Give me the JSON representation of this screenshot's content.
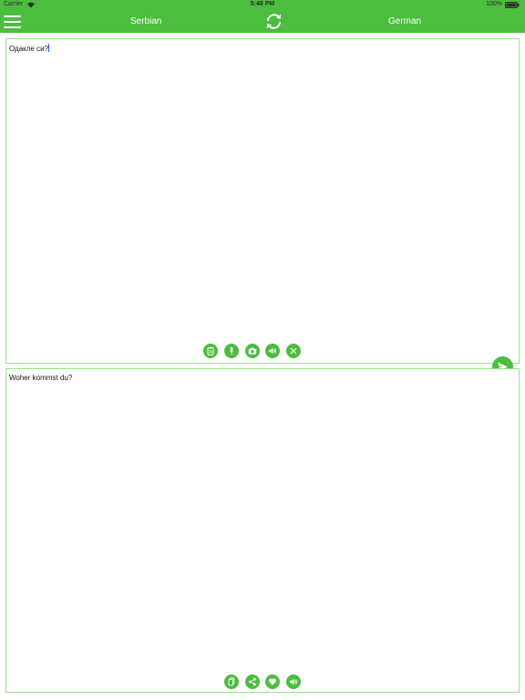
{
  "status_bar": {
    "carrier": "Carrier",
    "time": "5:48 PM",
    "battery": "100%"
  },
  "nav": {
    "source_language": "Serbian",
    "target_language": "German"
  },
  "input_panel": {
    "text": "Одакле си?"
  },
  "output_panel": {
    "text": "Woher kommst du?"
  },
  "icons": {
    "menu": "hamburger-menu-icon",
    "swap": "swap-languages-icon",
    "send": "send-icon",
    "input_tools": [
      "clipboard-icon",
      "microphone-icon",
      "camera-icon",
      "speaker-icon",
      "close-icon"
    ],
    "output_tools": [
      "copy-icon",
      "share-icon",
      "heart-icon",
      "speaker-icon"
    ]
  },
  "colors": {
    "accent": "#4cbd3f",
    "panel_border": "#9ae28c"
  }
}
